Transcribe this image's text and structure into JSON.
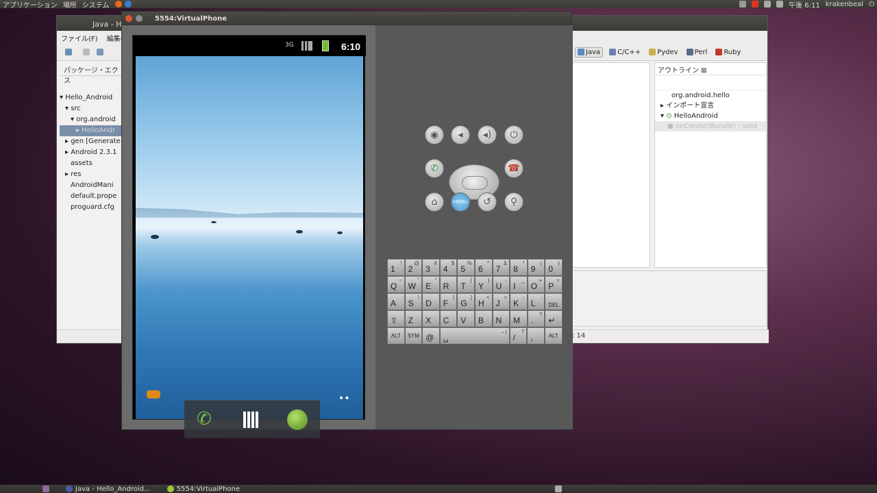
{
  "top_panel": {
    "menus": [
      "アプリケーション",
      "場所",
      "システム"
    ],
    "clock": "午後 6:11",
    "user": "krakenbeal"
  },
  "eclipse": {
    "title": "Java - He",
    "menu": [
      "ファイル(F)",
      "編集(F)"
    ],
    "perspectives": [
      {
        "label": "Java",
        "active": true
      },
      {
        "label": "C/C++"
      },
      {
        "label": "Pydev"
      },
      {
        "label": "Perl"
      },
      {
        "label": "Ruby"
      }
    ],
    "package_explorer": {
      "title": "パッケージ・エクス",
      "items": [
        "Hello_Android",
        "src",
        "org.android",
        "HelloAndr",
        "gen [Generate",
        "Android 2.3.1",
        "assets",
        "res",
        "AndroidMani",
        "default.prope",
        "proguard.cfg"
      ]
    },
    "outline": {
      "title": "アウトライン",
      "items": [
        "org.android.hello",
        "インポート宣言",
        "HelloAndroid",
        "onCreate(Bundle) : void"
      ]
    },
    "status_line": ": 14"
  },
  "emulator": {
    "title": "5554:VirtualPhone",
    "status_time": "6:10",
    "keyboard": {
      "row1": [
        [
          "1",
          "!"
        ],
        [
          "2",
          "@"
        ],
        [
          "3",
          "#"
        ],
        [
          "4",
          "$"
        ],
        [
          "5",
          "%"
        ],
        [
          "6",
          "^"
        ],
        [
          "7",
          "&"
        ],
        [
          "8",
          "*"
        ],
        [
          "9",
          "("
        ],
        [
          "0",
          ")"
        ]
      ],
      "row2": [
        [
          "Q",
          "~"
        ],
        [
          "W",
          "\""
        ],
        [
          "E",
          "\""
        ],
        [
          "R",
          ""
        ],
        [
          "T",
          "{"
        ],
        [
          "Y",
          "}"
        ],
        [
          "U",
          "-"
        ],
        [
          "I",
          "_"
        ],
        [
          "O",
          "+"
        ],
        [
          "P",
          "="
        ]
      ],
      "row3": [
        [
          "A",
          ""
        ],
        [
          "S",
          "\\"
        ],
        [
          "D",
          ""
        ],
        [
          "F",
          "["
        ],
        [
          "G",
          "]"
        ],
        [
          "H",
          "<"
        ],
        [
          "J",
          ">"
        ],
        [
          "K",
          ";"
        ],
        [
          "L",
          ":"
        ],
        [
          "DEL",
          ""
        ]
      ],
      "row4": [
        [
          "⇧",
          ""
        ],
        [
          "Z",
          ""
        ],
        [
          "X",
          ""
        ],
        [
          "C",
          ""
        ],
        [
          "V",
          ""
        ],
        [
          "B",
          ""
        ],
        [
          "N",
          ""
        ],
        [
          "M",
          ""
        ],
        [
          ".",
          "?"
        ],
        [
          "↵",
          ""
        ]
      ],
      "row5": [
        [
          "ALT",
          ""
        ],
        [
          "SYM",
          ""
        ],
        [
          "@",
          ""
        ],
        [
          "␣",
          "→|"
        ],
        [
          "/",
          "?"
        ],
        [
          ",",
          ""
        ],
        [
          "ALT",
          ""
        ]
      ]
    },
    "menu_button": "MENU"
  },
  "taskbar": {
    "tasks": [
      "Java - Hello_Android...",
      "5554:VirtualPhone"
    ]
  },
  "colors": {
    "screen_sky": "#5fa4d6",
    "emulator_bg": "#595959",
    "end_call": "#c0392b",
    "call": "#2e8b3a"
  }
}
